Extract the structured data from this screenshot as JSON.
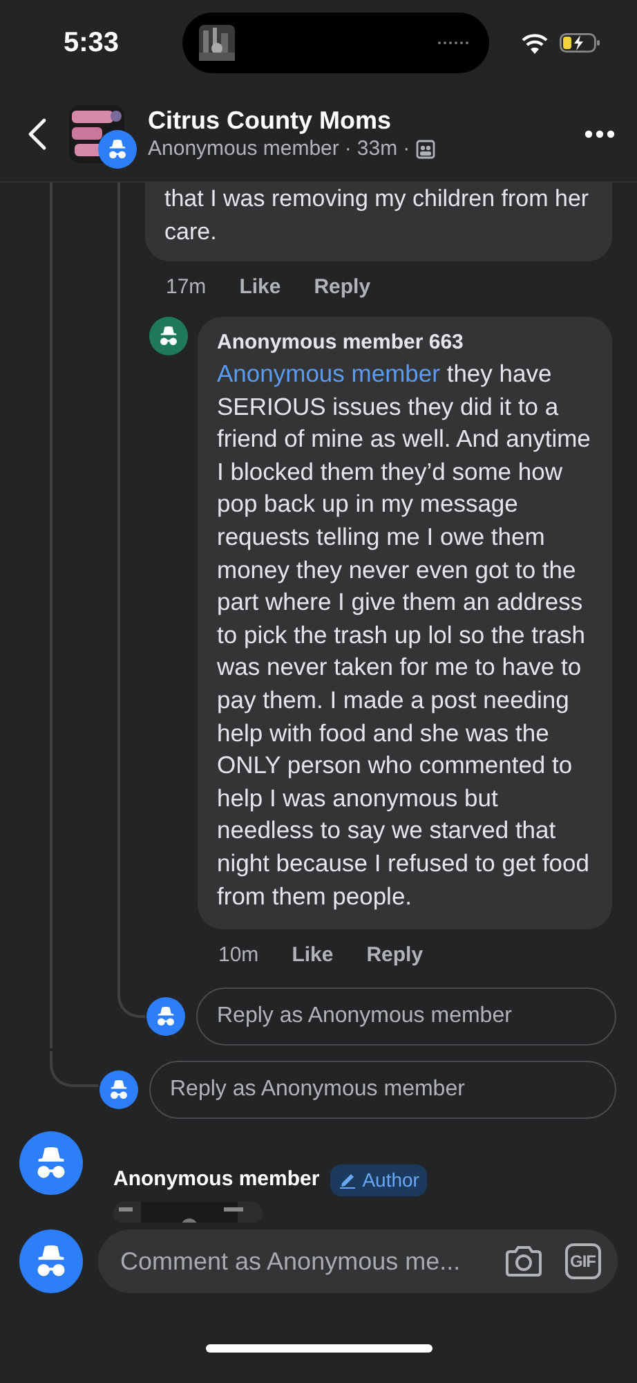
{
  "status_bar": {
    "time": "5:33"
  },
  "header": {
    "title": "Citrus County Moms",
    "author": "Anonymous member",
    "separator": "·",
    "time": "33m"
  },
  "thread": {
    "previous_comment": {
      "text": "that I was removing my children from her care.",
      "time": "17m",
      "actions": [
        "Like",
        "Reply"
      ]
    },
    "reply": {
      "author": "Anonymous member 663",
      "mention": "Anonymous member",
      "text": "they have SERIOUS issues they did it to a friend of mine as well. And anytime I blocked them they’d some how pop back up in my message requests telling me I owe them money they never even got to the part where I give them an address to pick the trash up lol so the trash was never taken for me to have to pay them. I made a post needing help with food and she was the ONLY person who commented to help I was anonymous but needless to say we starved that night because I refused to get food from them people.",
      "time": "10m",
      "actions": [
        "Like",
        "Reply"
      ]
    },
    "inner_reply_field": {
      "placeholder": "Reply as Anonymous member"
    },
    "outer_reply_field": {
      "placeholder": "Reply as Anonymous member"
    }
  },
  "next_comment": {
    "author": "Anonymous member",
    "badge": "Author"
  },
  "composer": {
    "placeholder": "Comment as Anonymous me...",
    "gif_label": "GIF"
  }
}
